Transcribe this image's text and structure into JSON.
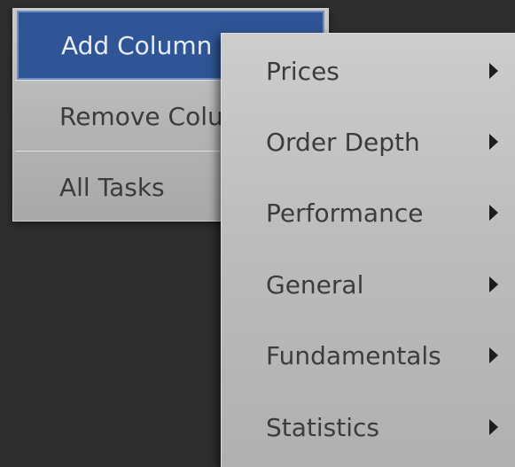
{
  "context_menu": {
    "items": [
      {
        "label": "Add Column",
        "selected": true
      },
      {
        "label": "Remove Colu",
        "selected": false
      },
      {
        "label": "All Tasks",
        "selected": false
      }
    ]
  },
  "submenu": {
    "items": [
      {
        "label": "Prices",
        "icon": "chevron-right-icon"
      },
      {
        "label": "Order Depth",
        "icon": "chevron-right-icon"
      },
      {
        "label": "Performance",
        "icon": "chevron-right-icon"
      },
      {
        "label": "General",
        "icon": "chevron-right-icon"
      },
      {
        "label": "Fundamentals",
        "icon": "chevron-right-icon"
      },
      {
        "label": "Statistics",
        "icon": "chevron-right-icon"
      }
    ]
  },
  "colors": {
    "background": "#2e2e2e",
    "selected": "#2f5597",
    "menu": "#bdbdbd",
    "text": "#3b3b3b"
  }
}
